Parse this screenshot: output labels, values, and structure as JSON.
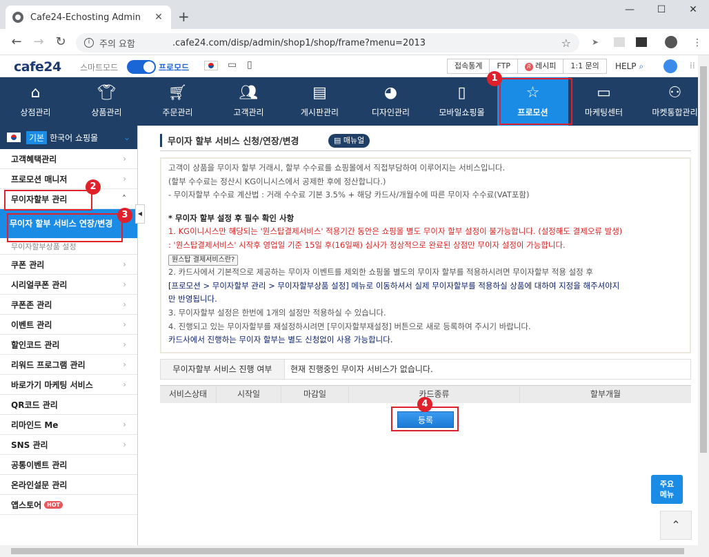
{
  "browser": {
    "tab_title": "Cafe24-Echosting Admin",
    "security_label": "주의 요함",
    "url": ".cafe24.com/disp/admin/shop1/shop/frame?menu=2013"
  },
  "topbar": {
    "logo": "cafe24",
    "mode_smart": "스마트모드",
    "mode_pro": "프로모드",
    "links": [
      "접속통계",
      "FTP",
      "레시피",
      "1:1 문의"
    ],
    "recipe_badge": "R",
    "help": "HELP"
  },
  "mainnav": [
    {
      "label": "상점관리",
      "icon": "home-icon"
    },
    {
      "label": "상품관리",
      "icon": "shirt-icon"
    },
    {
      "label": "주문관리",
      "icon": "cart-icon"
    },
    {
      "label": "고객관리",
      "icon": "users-icon"
    },
    {
      "label": "게시판관리",
      "icon": "board-icon"
    },
    {
      "label": "디자인관리",
      "icon": "palette-icon"
    },
    {
      "label": "모바일쇼핑몰",
      "icon": "mobile-icon"
    },
    {
      "label": "프로모션",
      "icon": "star-icon"
    },
    {
      "label": "마케팅센터",
      "icon": "monitor-icon"
    },
    {
      "label": "마켓통합관리",
      "icon": "network-icon"
    }
  ],
  "sidebar": {
    "shop_badge": "기본",
    "shop_name": "한국어 쇼핑몰",
    "items_top": [
      "고객혜택관리",
      "프로모션 매니저"
    ],
    "group": "무이자할부 관리",
    "sub_active": "무이자 할부 서비스 연장/변경",
    "sub_other": "무이자할부상품 설정",
    "items_bottom": [
      "쿠폰 관리",
      "시리얼쿠폰 관리",
      "쿠폰존 관리",
      "이벤트 관리",
      "할인코드 관리",
      "리워드 프로그램 관리",
      "바로가기 마케팅 서비스",
      "QR코드 관리",
      "리마인드 Me",
      "SNS 관리",
      "공통이벤트 관리",
      "온라인설문 관리",
      "앱스토어"
    ],
    "hot": "HOT"
  },
  "content": {
    "title": "무이자 할부 서비스 신청/연장/변경",
    "manual": "매뉴얼",
    "notice": {
      "l1": "고객이 상품을 무이자 할부 거래시, 할부 수수료를 쇼핑몰에서 직접부담하여 이루어지는 서비스입니다.",
      "l2": "(할부 수수료는 정산시 KG이니시스에서 공제한 후에 정산합니다.)",
      "l3": "- 무이자할부 수수료 계산법 : 거래 수수료 기본 3.5% + 해당 카드사/개월수에 따른 무이자 수수료(VAT포함)",
      "l4": "* 무이자 할부 설정 후 필수 확인 사항",
      "l5": "1. KG이니시스만 해당되는 '원스탑결제서비스' 적용기간 동안은 쇼핑몰 별도 무이자 할부 설정이 불가능합니다. (설정해도 결제오류 발생)",
      "l6": ": '원스탑결제서비스' 시작후 영업일 기준 15일 후(16일째) 심사가 정상적으로 완료된 상점만 무이자 설정이 가능합니다.",
      "onestop_btn": "원스탑 결제서비스란?",
      "l7": "2. 카드사에서 기본적으로 제공하는 무이자 이벤트를 제외한 쇼핑몰 별도의 무이자 할부를 적용하시려면 무이자할부 적용 설정 후",
      "l8": "[프로모션 > 무이자할부 관리 > 무이자할부상품 설정] 메뉴로 이동하셔서 실제 무이자할부를 적용하실 상품에 대하여 지정을 해주셔야지",
      "l9": "만 반영됩니다.",
      "l10": "3. 무이자할부 설정은 한번에 1개의 설정만 적용하실 수 있습니다.",
      "l11": "4. 진행되고 있는 무이자할부를 재설정하시려면 [무이자할부재설정] 버튼으로 새로 등록하여 주시기 바랍니다.",
      "l12": "카드사에서 진행하는 무이자 할부는 별도 신청없이 사용 가능합니다."
    },
    "status_label": "무이자할부 서비스 진행 여부",
    "status_value": "현재 진행중인 무이자 서비스가 없습니다.",
    "table_headers": [
      "서비스상태",
      "시작일",
      "마감일",
      "카드종류",
      "할부개월"
    ],
    "register": "등록"
  },
  "quick_menu": "주요\n메뉴",
  "annotations": [
    "1",
    "2",
    "3",
    "4"
  ],
  "colors": {
    "nav_bg": "#1f3f66",
    "accent": "#1a8ce6",
    "annotation": "#e0202a"
  }
}
